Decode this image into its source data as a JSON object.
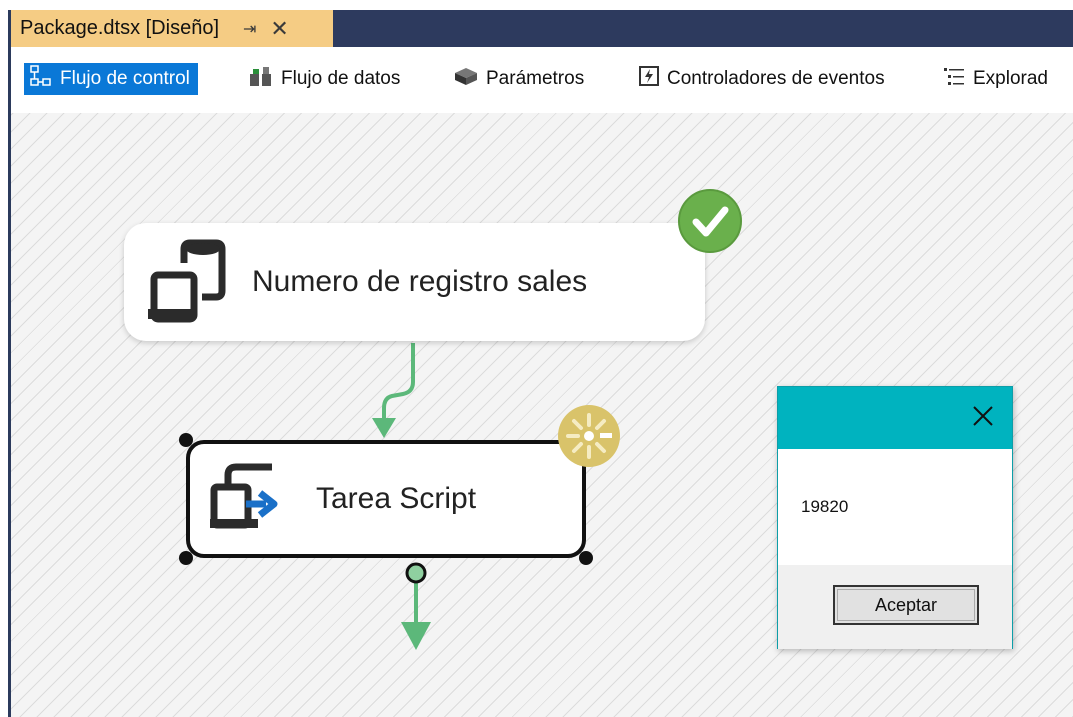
{
  "document_tab": {
    "title": "Package.dtsx [Diseño]",
    "pin_icon": "pin-icon",
    "close_icon": "close-icon"
  },
  "toolbar": {
    "items": [
      {
        "label": "Flujo de control",
        "icon": "control-flow-icon",
        "active": true
      },
      {
        "label": "Flujo de datos",
        "icon": "data-flow-icon",
        "active": false
      },
      {
        "label": "Parámetros",
        "icon": "parameters-icon",
        "active": false
      },
      {
        "label": "Controladores de eventos",
        "icon": "event-handlers-icon",
        "active": false
      },
      {
        "label": "Explorad",
        "icon": "package-explorer-icon",
        "active": false
      }
    ]
  },
  "canvas": {
    "tasks": [
      {
        "label": "Numero de registro sales",
        "icon": "sql-task-icon",
        "status": "success",
        "status_icon": "success-check-icon"
      },
      {
        "label": "Tarea Script",
        "icon": "script-task-icon",
        "status": "running",
        "status_icon": "running-spinner-icon",
        "selected": true
      }
    ]
  },
  "message_box": {
    "message": "19820",
    "ok_label": "Aceptar",
    "close_icon": "close-icon"
  },
  "colors": {
    "tab_bg": "#f5cc84",
    "tab_strip_bg": "#2d3a5e",
    "toolbar_active": "#0a78d7",
    "msgbox_titlebar": "#00b3bf",
    "connector": "#5cb87a",
    "success": "#6ab04c",
    "running": "#d9c36a"
  }
}
